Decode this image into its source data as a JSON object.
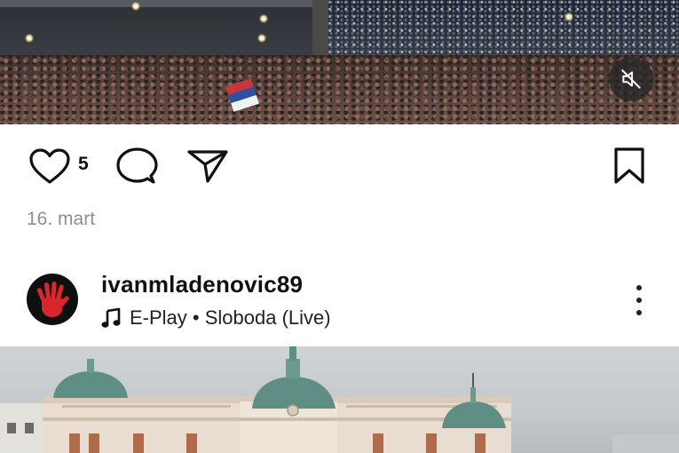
{
  "video": {
    "icons": {
      "mute": "speaker-muted-icon"
    }
  },
  "actions": {
    "like_count": "5",
    "date": "16. mart",
    "icons": {
      "like": "heart-icon",
      "comment": "comment-icon",
      "share": "send-icon",
      "save": "bookmark-icon"
    }
  },
  "next_post": {
    "username": "ivanmladenovic89",
    "audio": "E-Play • Sloboda (Live)",
    "icons": {
      "audio": "music-note-icon",
      "more": "more-options-icon"
    }
  },
  "colors": {
    "text": "#111111",
    "muted_text": "#8e8e8e",
    "avatar_hand": "#d8262d"
  }
}
